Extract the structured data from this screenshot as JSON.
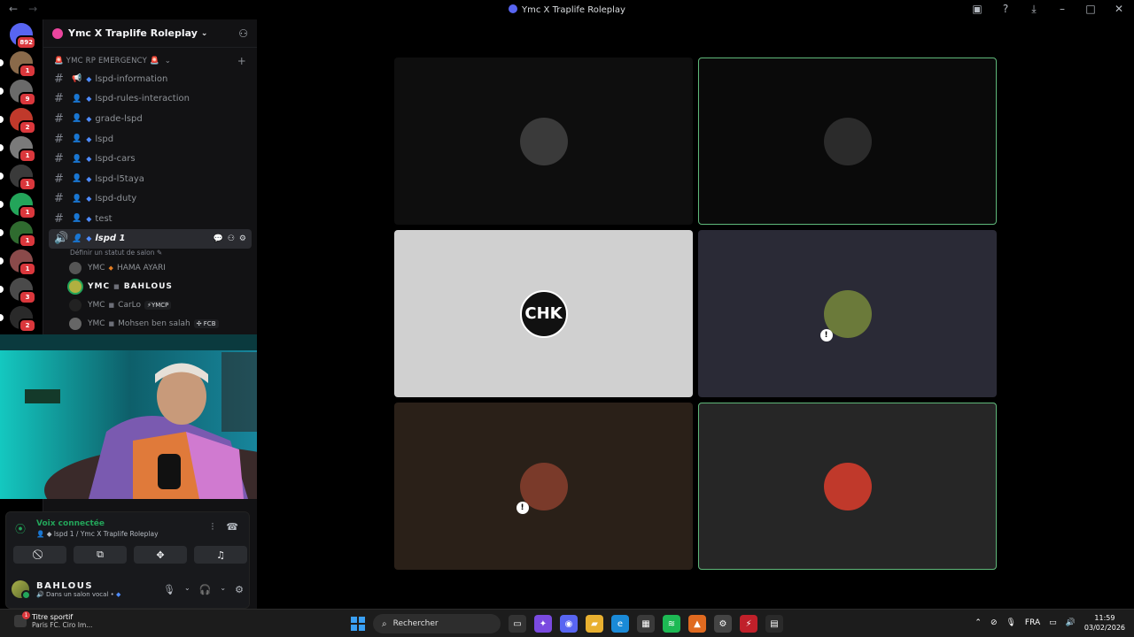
{
  "window": {
    "title": "Ymc X Traplife Roleplay"
  },
  "servers": [
    {
      "badge": "892",
      "color": "#5865f2"
    },
    {
      "badge": "1",
      "color": "#8a6a4a"
    },
    {
      "badge": "9",
      "color": "#6a6a6a"
    },
    {
      "badge": "2",
      "color": "#c0392b"
    },
    {
      "badge": "1",
      "color": "#7a7a7a"
    },
    {
      "badge": "1",
      "color": "#3a3a3a"
    },
    {
      "badge": "1",
      "color": "#23a55a"
    },
    {
      "badge": "1",
      "color": "#2f6b2f"
    },
    {
      "badge": "1",
      "color": "#8a4a4a"
    },
    {
      "badge": "3",
      "color": "#4a4a4a"
    },
    {
      "badge": "2",
      "color": "#2a2a2a"
    }
  ],
  "guild": {
    "name": "Ymc X Traplife Roleplay"
  },
  "category": {
    "label": "🚨 YMC RP EMERGENCY 🚨"
  },
  "channels": [
    {
      "name": "lspd-information"
    },
    {
      "name": "lspd-rules-interaction"
    },
    {
      "name": "grade-lspd"
    },
    {
      "name": "lspd"
    },
    {
      "name": "lspd-cars"
    },
    {
      "name": "lspd-l5taya"
    },
    {
      "name": "lspd-duty"
    },
    {
      "name": "test"
    }
  ],
  "active_channel": {
    "name": "lspd 1",
    "status_hint": "Définir un statut de salon"
  },
  "voice_users": [
    {
      "prefix": "YMC",
      "sep": "◆",
      "name": "HAMA AYARI",
      "tag": ""
    },
    {
      "prefix": "YMC",
      "sep": "■",
      "name": "BAHLOUS",
      "tag": ""
    },
    {
      "prefix": "YMC",
      "sep": "■",
      "name": "CarLo",
      "tag": "⚡YMCP"
    },
    {
      "prefix": "YMC",
      "sep": "■",
      "name": "Mohsen ben salah",
      "tag": "✣ FCB"
    }
  ],
  "voice_panel": {
    "title": "Voix connectée",
    "subtitle": "lspd 1 / Ymc X Traplife Roleplay"
  },
  "user": {
    "name": "BAHLOUS",
    "status": "Dans un salon vocal •"
  },
  "tiles": [
    {
      "bg": "#0e0e0e",
      "avatar": "#3a3a3a",
      "speaking": false,
      "deafened": false
    },
    {
      "bg": "#0a0a0a",
      "avatar": "#2b2b2b",
      "speaking": true,
      "deafened": false
    },
    {
      "bg": "#d0d0d0",
      "avatar": "#111111",
      "speaking": false,
      "deafened": false
    },
    {
      "bg": "#2a2a36",
      "avatar": "#6b7a3a",
      "speaking": false,
      "deafened": true
    },
    {
      "bg": "#2a2018",
      "avatar": "#7a3a2a",
      "speaking": false,
      "deafened": true
    },
    {
      "bg": "#262626",
      "avatar": "#c0392b",
      "speaking": true,
      "deafened": false
    }
  ],
  "tile_labels": {
    "chk": "CHK"
  },
  "taskbar": {
    "media_title": "Titre sportif",
    "media_sub": "Paris FC. Ciro Im...",
    "search_placeholder": "Rechercher",
    "lang": "FRA",
    "time": "11:59",
    "date": "03/02/2026"
  }
}
